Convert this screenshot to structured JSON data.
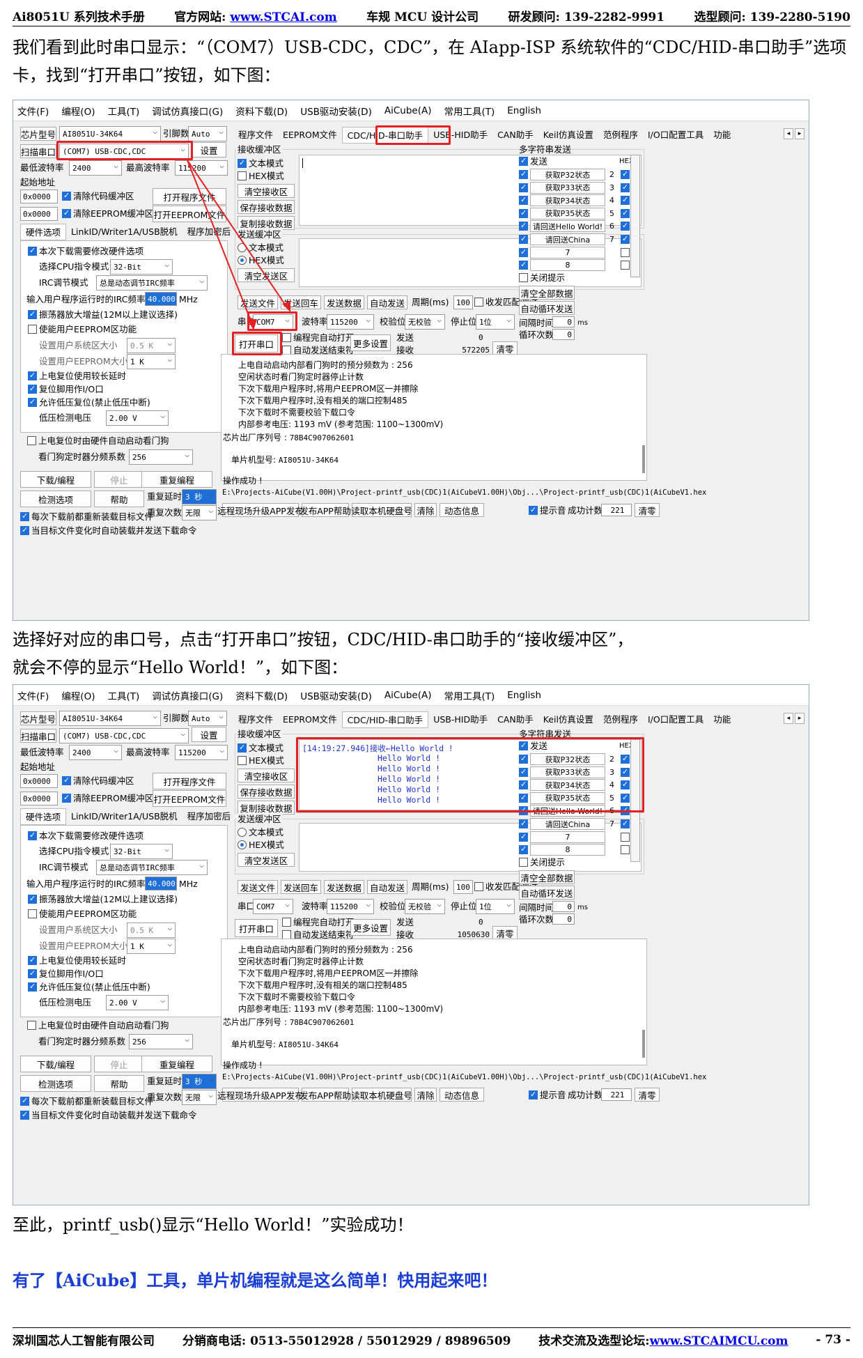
{
  "header": {
    "title": "Ai8051U 系列技术手册",
    "site_label": "官方网站: ",
    "site_url": "www.STCAI.com",
    "dept": "车规 MCU 设计公司",
    "r_and_d": "研发顾问: 139-2282-9991",
    "selection": "选型顾问: 139-2280-5190"
  },
  "para1": "我们看到此时串口显示：“（COM7）USB-CDC，CDC”，在 AIapp-ISP 系统软件的“CDC/HID-串口助手”选项卡，找到“打开串口”按钮，如下图：",
  "para2a": "选择好对应的串口号，点击“打开串口”按钮，CDC/HID-串口助手的“接收缓冲区”，",
  "para2b": "就会不停的显示“Hello World！”，如下图：",
  "para3": "至此，printf_usb()显示“Hello World！”实验成功！",
  "para4": "有了【AiCube】工具，单片机编程就是这么简单！快用起来吧！",
  "footer": {
    "company": "深圳国芯人工智能有限公司",
    "phone": "分销商电话: 0513-55012928 / 55012929 / 89896509",
    "forum_label": "技术交流及选型论坛:",
    "forum_url": "www.STCAIMCU.com",
    "page": "- 73 -"
  },
  "app": {
    "menu": [
      "文件(F)",
      "编程(O)",
      "工具(T)",
      "调试仿真接口(G)",
      "资料下载(D)",
      "USB驱动安装(D)",
      "AiCube(A)",
      "常用工具(T)",
      "English"
    ],
    "chip_label": "芯片型号",
    "chip_value": "AI8051U-34K64",
    "pins_label": "引脚数",
    "pins_value": "Auto",
    "scan_label": "扫描串口",
    "port_value": "(COM7) USB-CDC,CDC",
    "settings": "设置",
    "min_baud_label": "最低波特率",
    "min_baud": "2400",
    "max_baud_label": "最高波特率",
    "max_baud": "115200",
    "start_addr": "起始地址",
    "addr1": "0x0000",
    "clear_code": "清除代码缓冲区",
    "open_prog": "打开程序文件",
    "addr2": "0x0000",
    "clear_eeprom": "清除EEPROM缓冲区",
    "open_eeprom": "打开EEPROM文件",
    "left_tabs": [
      "硬件选项",
      "LinkID/Writer1A/USB脱机",
      "程序加密后"
    ],
    "opt_modify": "本次下载需要修改硬件选项",
    "cpu_mode_label": "选择CPU指令模式",
    "cpu_mode": "32-Bit",
    "irc_mode_label": "IRC调节模式",
    "irc_mode": "总是动态调节IRC频率",
    "irc_freq_label": "输入用户程序运行时的IRC频率",
    "irc_freq": "40.000",
    "mhz": "MHz",
    "osc_gain": "振荡器放大增益(12M以上建议选择)",
    "eeprom_func": "使能用户EEPROM区功能",
    "user_sector_label": "设置用户系统区大小",
    "user_sector": "0.5 K",
    "eeprom_size_label": "设置用户EEPROM大小",
    "eeprom_size": "1 K",
    "long_delay": "上电复位使用较长延时",
    "reset_io": "复位脚用作I/O口",
    "lvd_reset": "允许低压复位(禁止低压中断)",
    "lvd_label": "低压检测电压",
    "lvd": "2.00 V",
    "wdt_auto": "上电复位时由硬件自动启动看门狗",
    "wdt_div_label": "看门狗定时器分频系数",
    "wdt_div": "256",
    "download": "下载/编程",
    "stop": "停止",
    "reprogram": "重复编程",
    "check_opts": "检测选项",
    "help": "帮助",
    "retry_delay_label": "重复延时",
    "retry_delay": "3 秒",
    "retry_count_label": "重复次数",
    "retry_count": "无限",
    "reload_each": "每次下载前都重新装载目标文件",
    "auto_reload": "当目标文件变化时自动装载并发送下载命令",
    "right_tabs": [
      "程序文件",
      "EEPROM文件",
      "CDC/HID-串口助手",
      "USB-HID助手",
      "CAN助手",
      "Keil仿真设置",
      "范例程序",
      "I/O口配置工具",
      "功能"
    ],
    "rx_title": "接收缓冲区",
    "text_mode": "文本模式",
    "hex_mode": "HEX模式",
    "clear_rx": "清空接收区",
    "save_rx": "保存接收数据",
    "copy_rx": "复制接收数据",
    "tx_title": "发送缓冲区",
    "clear_tx": "清空发送区",
    "send_file": "发送文件",
    "send_enter": "发送回车",
    "send_data": "发送数据",
    "auto_send": "自动发送",
    "period_label": "周期(ms)",
    "period": "100",
    "match_label": "收发匹配测试",
    "port_label": "串口",
    "port": "COM7",
    "baud_label": "波特率",
    "baud": "115200",
    "parity_label": "校验位",
    "parity": "无校验",
    "stop_label": "停止位",
    "stop_bits": "1位",
    "open_port": "打开串口",
    "auto_open": "编程完自动打开",
    "auto_close": "自动发送结束符",
    "more_settings": "更多设置",
    "sent_label": "发送",
    "recv_label": "接收",
    "clear_count": "清零",
    "sent_count": "0",
    "multi_title": "多字符串发送",
    "send_col": "发送",
    "hex_col": "HEX",
    "multi_items": [
      "获取P32状态",
      "获取P33状态",
      "获取P34状态",
      "获取P35状态",
      "请回送Hello World!",
      "请回送China",
      "7",
      "8"
    ],
    "multi_idx": [
      "2",
      "3",
      "4",
      "5",
      "6",
      "7"
    ],
    "close_tip": "关闭提示",
    "clear_all": "清空全部数据",
    "auto_loop": "自动循环发送",
    "interval_label": "间隔时间",
    "interval": "0",
    "ms": "ms",
    "loop_label": "循环次数",
    "loop": "0",
    "log": [
      "上电自动启动内部看门狗时的预分频数为 : 256",
      "空闲状态时看门狗定时器停止计数",
      "下次下载用户程序时,将用户EEPROM区一并擦除",
      "下次下载用户程序时,没有相关的端口控制485",
      "下次下载时不需要校验下载口令",
      "内部参考电压: 1193 mV (参考范围: 1100~1300mV)"
    ],
    "serial_label": "芯片出厂序列号 :",
    "serial": "78B4C907062601",
    "model_label": "单片机型号:",
    "model": "AI8051U-34K64",
    "success": "操作成功 !",
    "path": "E:\\Projects-AiCube(V1.00H)\\Project-printf_usb(CDC)1(AiCubeV1.00H)\\Obj...\\Project-printf_usb(CDC)1(AiCubeV1.hex",
    "bottom_btns": [
      "远程现场升级APP发布",
      "发布APP帮助",
      "读取本机硬盘号",
      "清除",
      "动态信息"
    ],
    "beep": "提示音",
    "success_count_label": "成功计数",
    "success_count": "221",
    "clear_succ": "清零"
  },
  "shot1": {
    "recv_count": "572205"
  },
  "shot2": {
    "recv_count": "1050630",
    "rx_time": "[14:19:27.946]接收←Hello World !",
    "hello": "Hello World !"
  }
}
